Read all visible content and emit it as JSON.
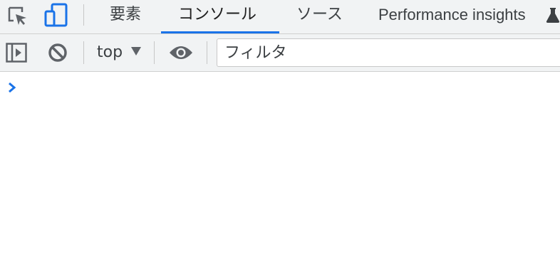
{
  "tabs": [
    {
      "label": "要素",
      "active": false
    },
    {
      "label": "コンソール",
      "active": true
    },
    {
      "label": "ソース",
      "active": false
    },
    {
      "label": "Performance insights",
      "active": false
    }
  ],
  "toolbar": {
    "context_label": "top",
    "filter_placeholder": "フィルタ"
  },
  "icons": {
    "inspect": "inspect-element-icon",
    "device": "device-toolbar-icon",
    "sidebar": "sidebar-toggle-icon",
    "clear": "clear-console-icon",
    "live_expression": "eye-icon",
    "experimental": "flask-icon",
    "prompt": "console-prompt-icon"
  },
  "colors": {
    "accent": "#1a73e8",
    "toolbar_bg": "#f1f3f4"
  }
}
